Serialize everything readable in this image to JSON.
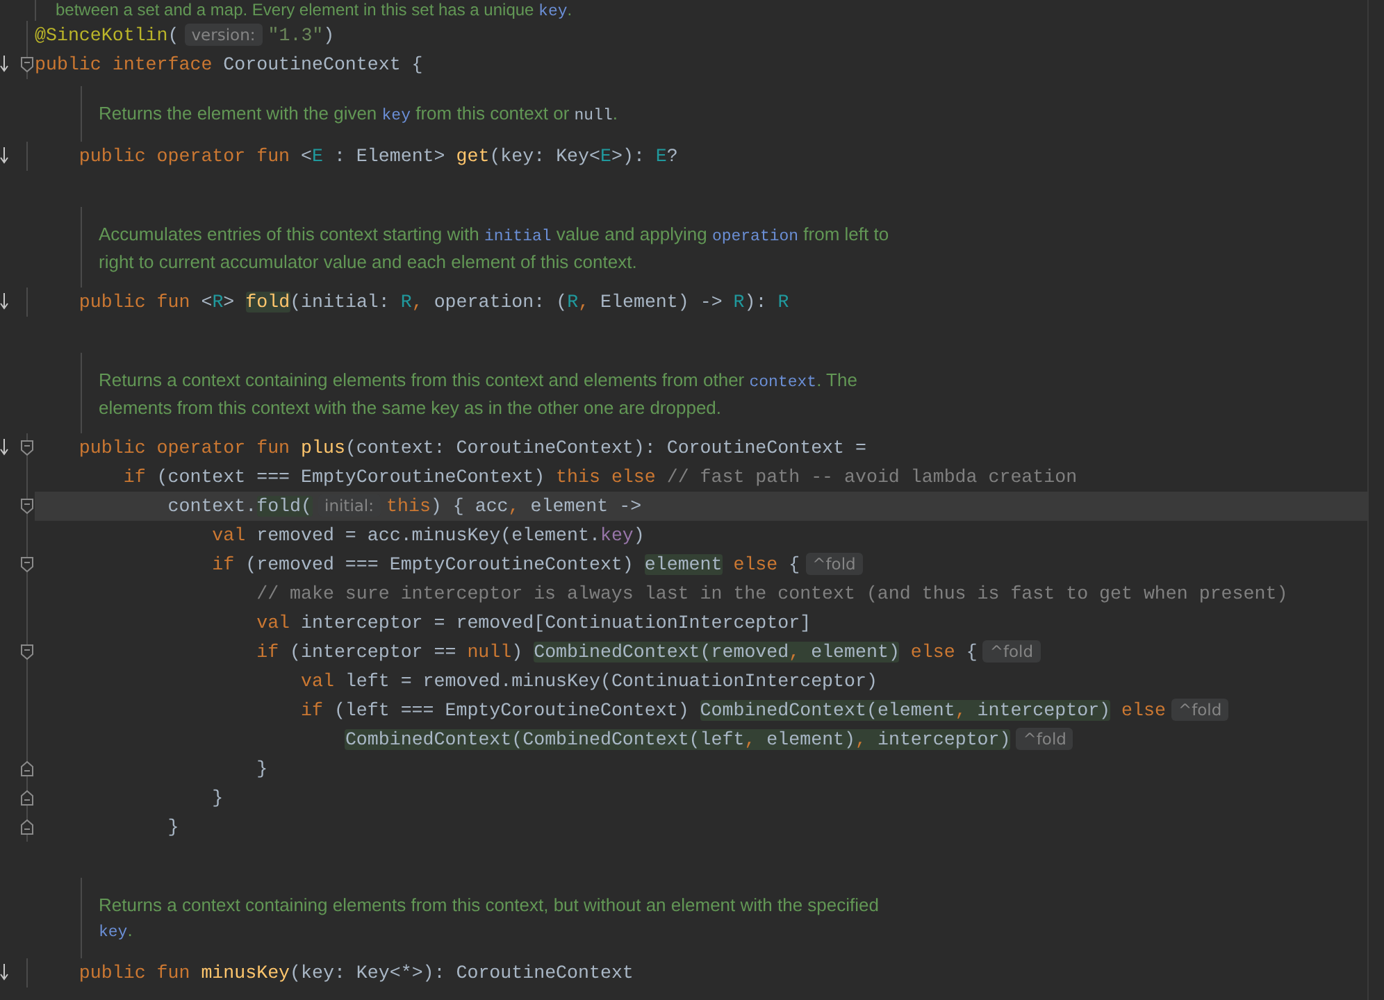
{
  "lines": [
    {
      "kind": "class-doc",
      "lines": [
        [
          {
            "kind": "text",
            "text": "between a set and a map. Every element in this set has a unique "
          },
          {
            "kind": "ref",
            "text": "key"
          },
          {
            "kind": "text",
            "text": "."
          }
        ]
      ]
    },
    {
      "kind": "code",
      "override": false,
      "fold_start": false,
      "fold_end": false,
      "current": false,
      "tokens": [
        {
          "kind": "ann",
          "text": "@SinceKotlin"
        },
        {
          "kind": "id",
          "text": "("
        },
        {
          "kind": "hint",
          "text": "version:"
        },
        {
          "kind": "str",
          "text": "\"1.3\""
        },
        {
          "kind": "id",
          "text": ")"
        }
      ]
    },
    {
      "kind": "code",
      "override": true,
      "fold_start": true,
      "fold_end": false,
      "current": false,
      "tokens": [
        {
          "kind": "kw",
          "text": "public interface "
        },
        {
          "kind": "id",
          "text": "CoroutineContext {"
        }
      ]
    },
    {
      "kind": "member-doc",
      "lines": [
        [
          {
            "kind": "text",
            "text": "Returns the element with the given "
          },
          {
            "kind": "ref",
            "text": "key"
          },
          {
            "kind": "text",
            "text": " from this context or "
          },
          {
            "kind": "code",
            "text": "null"
          },
          {
            "kind": "text",
            "text": "."
          }
        ]
      ]
    },
    {
      "kind": "code",
      "override": true,
      "fold_start": false,
      "fold_end": false,
      "current": false,
      "tokens": [
        {
          "kind": "kw",
          "text": "    public operator fun "
        },
        {
          "kind": "id",
          "text": "<"
        },
        {
          "kind": "tp",
          "text": "E"
        },
        {
          "kind": "id",
          "text": " : Element> "
        },
        {
          "kind": "fn",
          "text": "get"
        },
        {
          "kind": "id",
          "text": "(key: Key<"
        },
        {
          "kind": "tp",
          "text": "E"
        },
        {
          "kind": "id",
          "text": ">): "
        },
        {
          "kind": "tp",
          "text": "E"
        },
        {
          "kind": "id",
          "text": "?"
        }
      ]
    },
    {
      "kind": "blank"
    },
    {
      "kind": "member-doc",
      "lines": [
        [
          {
            "kind": "text",
            "text": "Accumulates entries of this context starting with "
          },
          {
            "kind": "ref",
            "text": "initial"
          },
          {
            "kind": "text",
            "text": " value and applying "
          },
          {
            "kind": "ref",
            "text": "operation"
          },
          {
            "kind": "text",
            "text": " from left to"
          }
        ],
        [
          {
            "kind": "text",
            "text": "right to current accumulator value and each element of this context."
          }
        ]
      ]
    },
    {
      "kind": "code",
      "override": true,
      "fold_start": false,
      "fold_end": false,
      "current": false,
      "tokens": [
        {
          "kind": "kw",
          "text": "    public fun "
        },
        {
          "kind": "id",
          "text": "<"
        },
        {
          "kind": "tp",
          "text": "R"
        },
        {
          "kind": "id",
          "text": "> "
        },
        {
          "kind": "hl",
          "tokens": [
            {
              "kind": "fn",
              "text": "fold"
            }
          ]
        },
        {
          "kind": "id",
          "text": "(initial: "
        },
        {
          "kind": "tp",
          "text": "R"
        },
        {
          "kind": "punct",
          "text": ", "
        },
        {
          "kind": "id",
          "text": "operation: ("
        },
        {
          "kind": "tp",
          "text": "R"
        },
        {
          "kind": "punct",
          "text": ", "
        },
        {
          "kind": "id",
          "text": "Element) -> "
        },
        {
          "kind": "tp",
          "text": "R"
        },
        {
          "kind": "id",
          "text": "): "
        },
        {
          "kind": "tp",
          "text": "R"
        }
      ]
    },
    {
      "kind": "blank"
    },
    {
      "kind": "member-doc",
      "lines": [
        [
          {
            "kind": "text",
            "text": "Returns a context containing elements from this context and elements from other "
          },
          {
            "kind": "ref",
            "text": "context"
          },
          {
            "kind": "text",
            "text": ". The"
          }
        ],
        [
          {
            "kind": "text",
            "text": "elements from this context with the same key as in the other one are dropped."
          }
        ]
      ]
    },
    {
      "kind": "code",
      "override": true,
      "fold_start": true,
      "fold_end": false,
      "current": false,
      "tokens": [
        {
          "kind": "kw",
          "text": "    public operator fun "
        },
        {
          "kind": "fn",
          "text": "plus"
        },
        {
          "kind": "id",
          "text": "(context: CoroutineContext): CoroutineContext ="
        }
      ]
    },
    {
      "kind": "code",
      "override": false,
      "fold_start": false,
      "fold_end": false,
      "current": false,
      "tokens": [
        {
          "kind": "kw",
          "text": "        if "
        },
        {
          "kind": "id",
          "text": "(context === EmptyCoroutineContext) "
        },
        {
          "kind": "kw",
          "text": "this else "
        },
        {
          "kind": "cm",
          "text": "// fast path -- avoid lambda creation"
        }
      ]
    },
    {
      "kind": "code",
      "override": false,
      "fold_start": true,
      "fold_end": false,
      "current": true,
      "tokens": [
        {
          "kind": "id",
          "text": "            context."
        },
        {
          "kind": "hl",
          "tokens": [
            {
              "kind": "id",
              "text": "fold("
            }
          ]
        },
        {
          "kind": "hint",
          "text": "initial:"
        },
        {
          "kind": "kw",
          "text": "this"
        },
        {
          "kind": "id",
          "text": ") { acc"
        },
        {
          "kind": "punct",
          "text": ", "
        },
        {
          "kind": "id",
          "text": "element ->"
        }
      ]
    },
    {
      "kind": "code",
      "override": false,
      "fold_start": false,
      "fold_end": false,
      "current": false,
      "tokens": [
        {
          "kind": "kw",
          "text": "                val "
        },
        {
          "kind": "id",
          "text": "removed = acc.minusKey(element."
        },
        {
          "kind": "prop",
          "text": "key"
        },
        {
          "kind": "id",
          "text": ")"
        }
      ]
    },
    {
      "kind": "code",
      "override": false,
      "fold_start": true,
      "fold_end": false,
      "current": false,
      "tokens": [
        {
          "kind": "kw",
          "text": "                if "
        },
        {
          "kind": "id",
          "text": "(removed === EmptyCoroutineContext) "
        },
        {
          "kind": "hl",
          "tokens": [
            {
              "kind": "id",
              "text": "element"
            }
          ]
        },
        {
          "kind": "kw",
          "text": " else "
        },
        {
          "kind": "id",
          "text": "{"
        },
        {
          "kind": "fold",
          "text": "^fold"
        }
      ]
    },
    {
      "kind": "code",
      "override": false,
      "fold_start": false,
      "fold_end": false,
      "current": false,
      "tokens": [
        {
          "kind": "cm",
          "text": "                    // make sure interceptor is always last in the context (and thus is fast to get when present)"
        }
      ]
    },
    {
      "kind": "code",
      "override": false,
      "fold_start": false,
      "fold_end": false,
      "current": false,
      "tokens": [
        {
          "kind": "kw",
          "text": "                    val "
        },
        {
          "kind": "id",
          "text": "interceptor = removed[ContinuationInterceptor]"
        }
      ]
    },
    {
      "kind": "code",
      "override": false,
      "fold_start": true,
      "fold_end": false,
      "current": false,
      "tokens": [
        {
          "kind": "kw",
          "text": "                    if "
        },
        {
          "kind": "id",
          "text": "(interceptor == "
        },
        {
          "kind": "kw",
          "text": "null"
        },
        {
          "kind": "id",
          "text": ") "
        },
        {
          "kind": "hl",
          "tokens": [
            {
              "kind": "id",
              "text": "CombinedContext(removed"
            },
            {
              "kind": "punct",
              "text": ", "
            },
            {
              "kind": "id",
              "text": "element)"
            }
          ]
        },
        {
          "kind": "kw",
          "text": " else "
        },
        {
          "kind": "id",
          "text": "{"
        },
        {
          "kind": "fold",
          "text": "^fold"
        }
      ]
    },
    {
      "kind": "code",
      "override": false,
      "fold_start": false,
      "fold_end": false,
      "current": false,
      "tokens": [
        {
          "kind": "kw",
          "text": "                        val "
        },
        {
          "kind": "id",
          "text": "left = removed.minusKey(ContinuationInterceptor)"
        }
      ]
    },
    {
      "kind": "code",
      "override": false,
      "fold_start": false,
      "fold_end": false,
      "current": false,
      "tokens": [
        {
          "kind": "kw",
          "text": "                        if "
        },
        {
          "kind": "id",
          "text": "(left === EmptyCoroutineContext) "
        },
        {
          "kind": "hl",
          "tokens": [
            {
              "kind": "id",
              "text": "CombinedContext(element"
            },
            {
              "kind": "punct",
              "text": ", "
            },
            {
              "kind": "id",
              "text": "interceptor)"
            }
          ]
        },
        {
          "kind": "kw",
          "text": " else"
        },
        {
          "kind": "fold",
          "text": "^fold"
        }
      ]
    },
    {
      "kind": "code",
      "override": false,
      "fold_start": false,
      "fold_end": false,
      "current": false,
      "tokens": [
        {
          "kind": "hl",
          "tokens": [
            {
              "kind": "id",
              "text": "                            CombinedContext(CombinedContext(left"
            },
            {
              "kind": "punct",
              "text": ", "
            },
            {
              "kind": "id",
              "text": "element)"
            },
            {
              "kind": "punct",
              "text": ", "
            },
            {
              "kind": "id",
              "text": "interceptor)"
            }
          ]
        },
        {
          "kind": "fold",
          "text": "^fold"
        }
      ]
    },
    {
      "kind": "code",
      "override": false,
      "fold_start": false,
      "fold_end": true,
      "current": false,
      "tokens": [
        {
          "kind": "id",
          "text": "                    }"
        }
      ]
    },
    {
      "kind": "code",
      "override": false,
      "fold_start": false,
      "fold_end": true,
      "current": false,
      "tokens": [
        {
          "kind": "id",
          "text": "                }"
        }
      ]
    },
    {
      "kind": "code",
      "override": false,
      "fold_start": false,
      "fold_end": true,
      "current": false,
      "tokens": [
        {
          "kind": "id",
          "text": "            }"
        }
      ]
    },
    {
      "kind": "blank"
    },
    {
      "kind": "member-doc",
      "lines": [
        [
          {
            "kind": "text",
            "text": "Returns a context containing elements from this context, but without an element with the specified"
          }
        ],
        [
          {
            "kind": "ref",
            "text": "key"
          },
          {
            "kind": "text",
            "text": "."
          }
        ]
      ]
    },
    {
      "kind": "code",
      "override": true,
      "fold_start": false,
      "fold_end": false,
      "current": false,
      "tokens": [
        {
          "kind": "kw",
          "text": "    public fun "
        },
        {
          "kind": "fn",
          "text": "minusKey"
        },
        {
          "kind": "id",
          "text": "(key: Key<*>): CoroutineContext"
        }
      ]
    }
  ]
}
